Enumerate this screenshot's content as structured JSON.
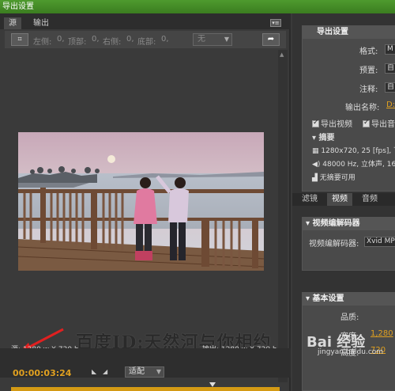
{
  "window": {
    "title": "导出设置"
  },
  "source_panel": {
    "tabs": [
      "源",
      "输出"
    ],
    "crop": {
      "left_label": "左侧:",
      "left_value": "0,",
      "top_label": "顶部:",
      "top_value": "0,",
      "right_label": "右侧:",
      "right_value": "0,",
      "bottom_label": "底部:",
      "bottom_value": "0,",
      "ratio_value": "无"
    },
    "source_info": "源: 1280 w X 720 h",
    "output_info": "输出: 1280 w X 720 h",
    "timecode": "00:00:03:24",
    "zoom_value": "适配",
    "progress_fraction": 0.92
  },
  "watermark": "百度ID:天然河与你相约",
  "export_settings": {
    "title": "导出设置",
    "format_label": "格式:",
    "format_value": "M",
    "preset_label": "预置:",
    "preset_value": "自",
    "comment_label": "注释:",
    "comment_value": "自",
    "output_name_label": "输出名称:",
    "output_name_value": "D:",
    "export_video_label": "导出视频",
    "export_audio_label": "导出音",
    "summary_label": "摘要",
    "summary_video": "1280x720, 25 [fps], 下",
    "summary_audio": "48000 Hz, 立体声, 16",
    "summary_none": "无摘要可用"
  },
  "right_tabs": [
    "滤镜",
    "视频",
    "音频"
  ],
  "video_codec": {
    "title": "视频编解码器",
    "codec_label": "视频编解码器:",
    "codec_value": "Xvid MP"
  },
  "basic_settings": {
    "title": "基本设置",
    "quality_label": "品质:",
    "width_label": "宽度:",
    "width_value": "1,280",
    "height_label": "高度:",
    "height_value": "720"
  },
  "site_watermark": {
    "brand": "Bai 经验",
    "url": "jingyan.baidu.com"
  },
  "colors": {
    "accent": "#e0a020",
    "title_bar": "#4e9a2e",
    "annotation_arrow": "#e02020"
  }
}
